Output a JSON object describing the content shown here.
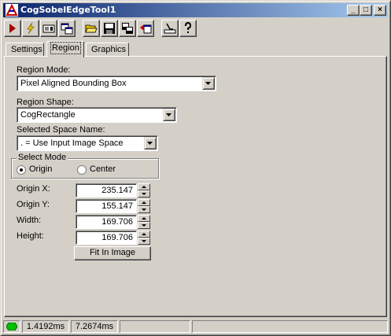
{
  "window": {
    "title": "CogSobelEdgeTool1",
    "caption_buttons": {
      "minimize": "_",
      "maximize": "□",
      "close": "×"
    }
  },
  "toolbar": {
    "buttons": [
      {
        "name": "run",
        "icon": "run-arrow-icon"
      },
      {
        "name": "electric-mode",
        "icon": "lightning-icon"
      },
      {
        "name": "show-image",
        "icon": "image-display-icon"
      },
      {
        "name": "local-display",
        "icon": "window-link-icon"
      },
      {
        "name": "open",
        "icon": "folder-open-icon"
      },
      {
        "name": "save",
        "icon": "floppy-disk-icon"
      },
      {
        "name": "save-as",
        "icon": "save-settings-icon"
      },
      {
        "name": "reset",
        "icon": "reset-icon"
      },
      {
        "name": "clear",
        "icon": "clear-icon"
      },
      {
        "name": "help",
        "icon": "help-icon"
      }
    ]
  },
  "tabs": [
    {
      "label": "Settings",
      "active": false
    },
    {
      "label": "Region",
      "active": true
    },
    {
      "label": "Graphics",
      "active": false
    }
  ],
  "region": {
    "mode_label": "Region Mode:",
    "mode_value": "Pixel Aligned Bounding Box",
    "shape_label": "Region Shape:",
    "shape_value": "CogRectangle",
    "space_label": "Selected Space Name:",
    "space_value": ". = Use Input Image Space",
    "select_mode": {
      "legend": "Select Mode",
      "options": [
        {
          "label": "Origin",
          "checked": true
        },
        {
          "label": "Center",
          "checked": false
        }
      ]
    },
    "fields": [
      {
        "label": "Origin X:",
        "value": "235.147"
      },
      {
        "label": "Origin Y:",
        "value": "155.147"
      },
      {
        "label": "Width:",
        "value": "169.706"
      },
      {
        "label": "Height:",
        "value": "169.706"
      }
    ],
    "fit_button": "Fit In Image"
  },
  "status": {
    "indicator_color": "#00c000",
    "time1": "1.4192ms",
    "time2": "7.2674ms"
  }
}
